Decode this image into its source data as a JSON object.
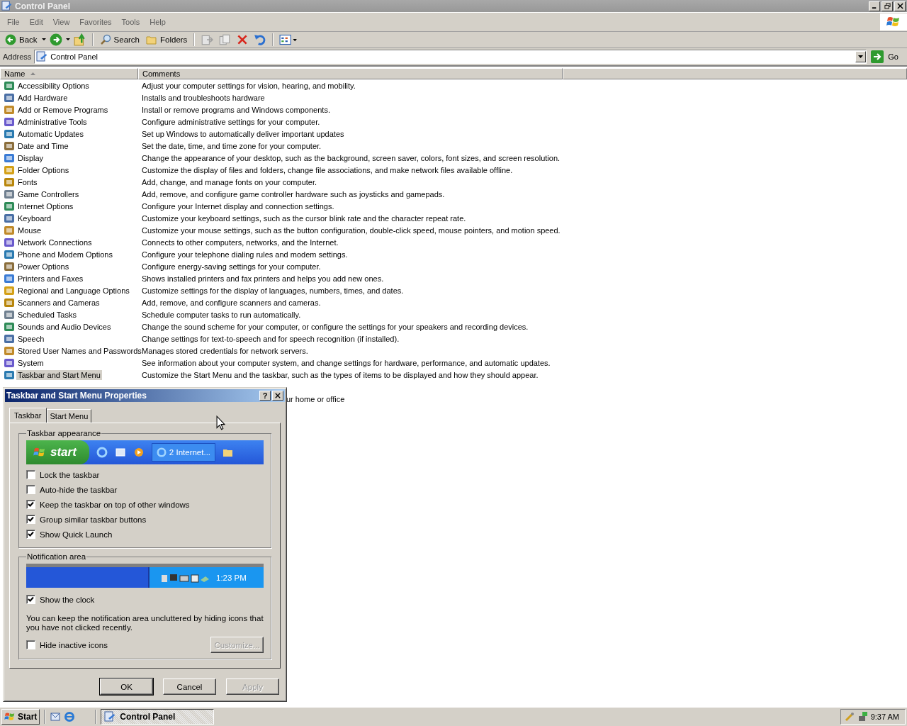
{
  "window": {
    "title": "Control Panel"
  },
  "menu": [
    "File",
    "Edit",
    "View",
    "Favorites",
    "Tools",
    "Help"
  ],
  "toolbar": {
    "back": "Back",
    "search": "Search",
    "folders": "Folders"
  },
  "address": {
    "label": "Address",
    "value": "Control Panel",
    "go": "Go"
  },
  "columns": [
    "Name",
    "Comments"
  ],
  "rows": [
    {
      "name": "Accessibility Options",
      "comment": "Adjust your computer settings for vision, hearing, and mobility.",
      "selected": false
    },
    {
      "name": "Add Hardware",
      "comment": "Installs and troubleshoots hardware",
      "selected": false
    },
    {
      "name": "Add or Remove Programs",
      "comment": "Install or remove programs and Windows components.",
      "selected": false
    },
    {
      "name": "Administrative Tools",
      "comment": "Configure administrative settings for your computer.",
      "selected": false
    },
    {
      "name": "Automatic Updates",
      "comment": "Set up Windows to automatically deliver important updates",
      "selected": false
    },
    {
      "name": "Date and Time",
      "comment": "Set the date, time, and time zone for your computer.",
      "selected": false
    },
    {
      "name": "Display",
      "comment": "Change the appearance of your desktop, such as the background, screen saver, colors, font sizes, and screen resolution.",
      "selected": false
    },
    {
      "name": "Folder Options",
      "comment": "Customize the display of files and folders, change file associations, and make network files available offline.",
      "selected": false
    },
    {
      "name": "Fonts",
      "comment": "Add, change, and manage fonts on your computer.",
      "selected": false
    },
    {
      "name": "Game Controllers",
      "comment": "Add, remove, and configure game controller hardware such as joysticks and gamepads.",
      "selected": false
    },
    {
      "name": "Internet Options",
      "comment": "Configure your Internet display and connection settings.",
      "selected": false
    },
    {
      "name": "Keyboard",
      "comment": "Customize your keyboard settings, such as the cursor blink rate and the character repeat rate.",
      "selected": false
    },
    {
      "name": "Mouse",
      "comment": "Customize your mouse settings, such as the button configuration, double-click speed, mouse pointers, and motion speed.",
      "selected": false
    },
    {
      "name": "Network Connections",
      "comment": "Connects to other computers, networks, and the Internet.",
      "selected": false
    },
    {
      "name": "Phone and Modem Options",
      "comment": "Configure your telephone dialing rules and modem settings.",
      "selected": false
    },
    {
      "name": "Power Options",
      "comment": "Configure energy-saving settings for your computer.",
      "selected": false
    },
    {
      "name": "Printers and Faxes",
      "comment": "Shows installed printers and fax printers and helps you add new ones.",
      "selected": false
    },
    {
      "name": "Regional and Language Options",
      "comment": "Customize settings for the display of languages, numbers, times, and dates.",
      "selected": false
    },
    {
      "name": "Scanners and Cameras",
      "comment": "Add, remove, and configure scanners and cameras.",
      "selected": false
    },
    {
      "name": "Scheduled Tasks",
      "comment": "Schedule computer tasks to run automatically.",
      "selected": false
    },
    {
      "name": "Sounds and Audio Devices",
      "comment": "Change the sound scheme for your computer, or configure the settings for your speakers and recording devices.",
      "selected": false
    },
    {
      "name": "Speech",
      "comment": "Change settings for text-to-speech and for speech recognition (if installed).",
      "selected": false
    },
    {
      "name": "Stored User Names and Passwords",
      "comment": "Manages stored credentials for network servers.",
      "selected": false
    },
    {
      "name": "System",
      "comment": "See information about your computer system, and change settings for hardware, performance, and automatic updates.",
      "selected": false
    },
    {
      "name": "Taskbar and Start Menu",
      "comment": "Customize the Start Menu and the taskbar, such as the types of items to be displayed and how they should appear.",
      "selected": true
    }
  ],
  "covered_comment": "ur home or office",
  "dialog": {
    "title": "Taskbar and Start Menu Properties",
    "help": "?",
    "tabs": [
      {
        "label": "Taskbar",
        "selected": true
      },
      {
        "label": "Start Menu",
        "selected": false
      }
    ],
    "appearance": {
      "legend": "Taskbar appearance",
      "preview_start": "start",
      "preview_button": "2 Internet...",
      "options": [
        {
          "label": "Lock the taskbar",
          "checked": false
        },
        {
          "label": "Auto-hide the taskbar",
          "checked": false
        },
        {
          "label": "Keep the taskbar on top of other windows",
          "checked": true
        },
        {
          "label": "Group similar taskbar buttons",
          "checked": true
        },
        {
          "label": "Show Quick Launch",
          "checked": true
        }
      ]
    },
    "notification": {
      "legend": "Notification area",
      "preview_time": "1:23 PM",
      "clock": {
        "label": "Show the clock",
        "checked": true
      },
      "note": "You can keep the notification area uncluttered by hiding icons that you have not clicked recently.",
      "hide": {
        "label": "Hide inactive icons",
        "checked": false
      },
      "customize": {
        "label": "Customize...",
        "disabled": true
      }
    },
    "buttons": [
      {
        "label": "OK",
        "disabled": false,
        "default": true
      },
      {
        "label": "Cancel",
        "disabled": false,
        "default": false
      },
      {
        "label": "Apply",
        "disabled": true,
        "default": false
      }
    ]
  },
  "taskbar": {
    "start": "Start",
    "task": "Control Panel",
    "time": "9:37 AM"
  }
}
